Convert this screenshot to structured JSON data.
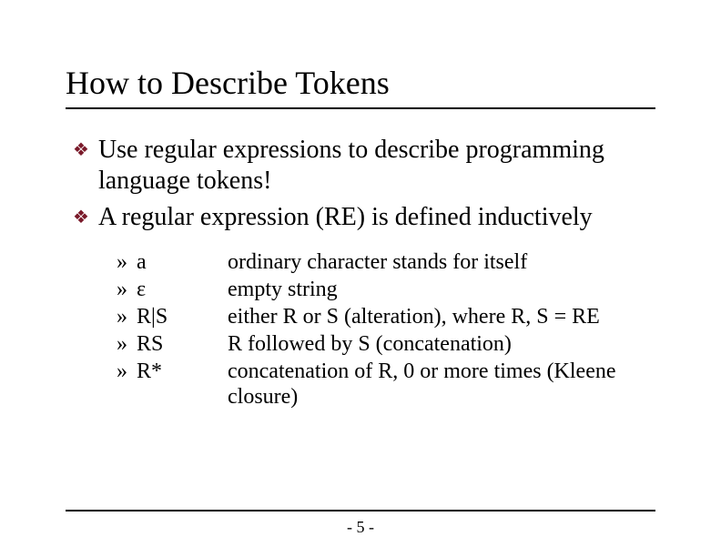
{
  "title": "How to Describe Tokens",
  "bullets": [
    "Use regular expressions to describe programming language tokens!",
    "A regular expression (RE) is defined inductively"
  ],
  "sub": [
    {
      "sym": "a",
      "desc": "ordinary character stands for itself"
    },
    {
      "sym": "ε",
      "desc": "empty string"
    },
    {
      "sym": "R|S",
      "desc": "either R or S (alteration), where R, S = RE"
    },
    {
      "sym": "RS",
      "desc": "R followed by S (concatenation)"
    },
    {
      "sym": "R*",
      "desc": "concatenation of R, 0 or more times (Kleene closure)"
    }
  ],
  "marker_diamond": "❖",
  "marker_raquo": "»",
  "page": "- 5 -"
}
